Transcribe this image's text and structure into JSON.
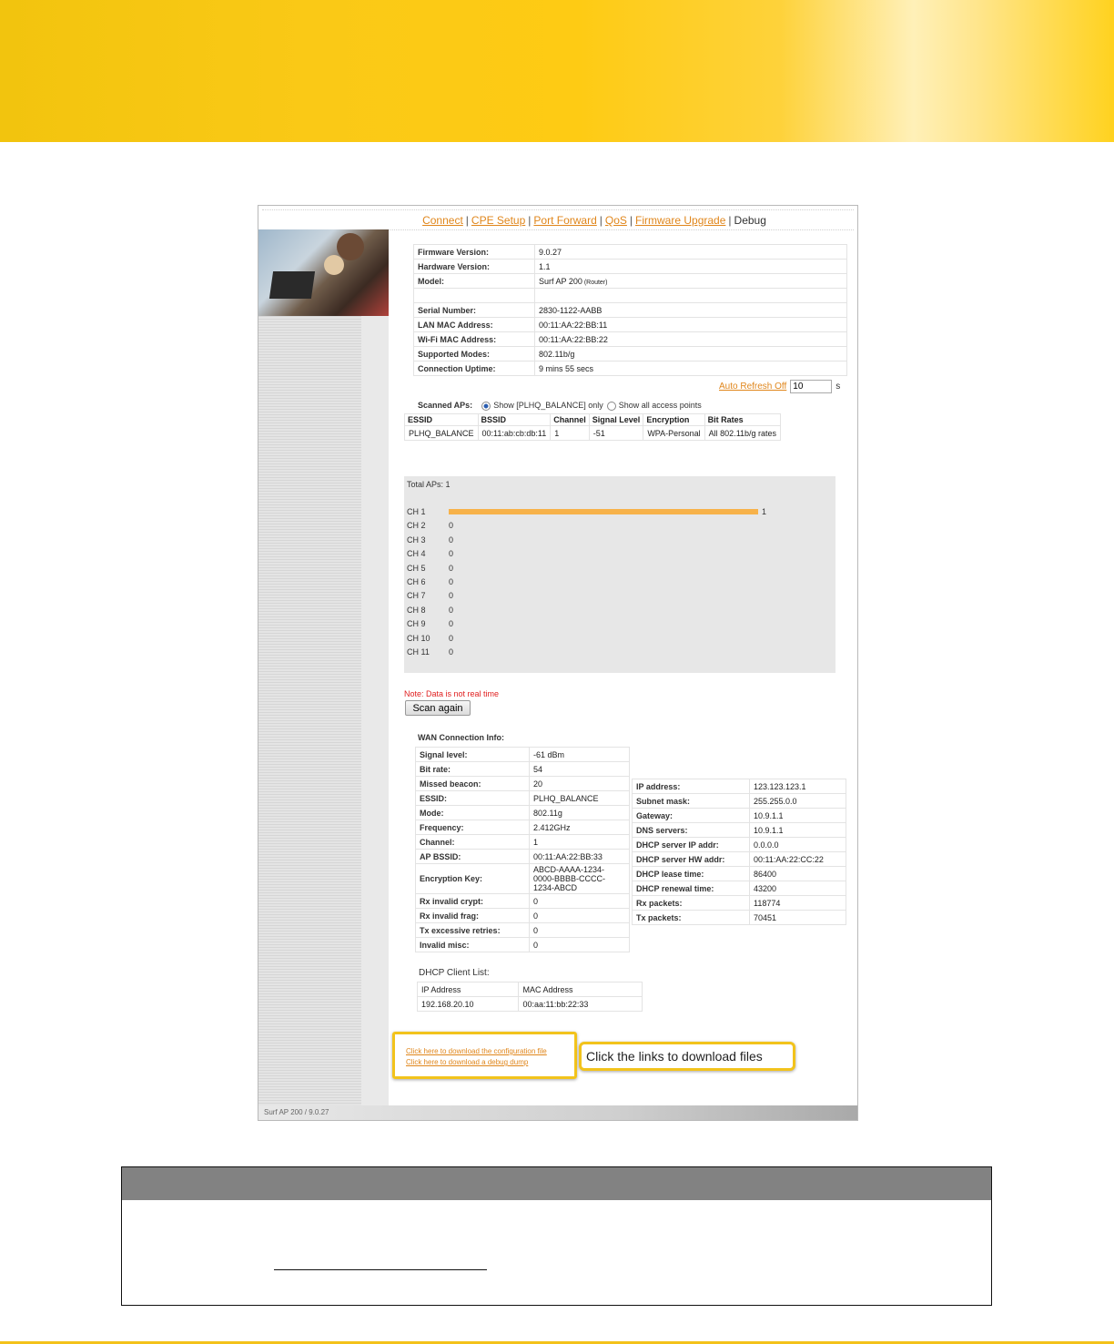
{
  "nav": {
    "items": [
      "Connect",
      "CPE Setup",
      "Port Forward",
      "QoS",
      "Firmware Upgrade"
    ],
    "current": "Debug"
  },
  "info": [
    {
      "k": "Firmware Version:",
      "v": "9.0.27"
    },
    {
      "k": "Hardware Version:",
      "v": "1.1"
    },
    {
      "k": "Model:",
      "v": "Surf AP 200",
      "extra": "(Router)"
    },
    {
      "k": "",
      "v": ""
    },
    {
      "k": "Serial Number:",
      "v": "2830-1122-AABB"
    },
    {
      "k": "LAN MAC Address:",
      "v": "00:11:AA:22:BB:11"
    },
    {
      "k": "Wi-Fi MAC Address:",
      "v": "00:11:AA:22:BB:22"
    },
    {
      "k": "Supported Modes:",
      "v": "802.11b/g"
    },
    {
      "k": "Connection Uptime:",
      "v": "9 mins 55 secs"
    }
  ],
  "refresh": {
    "link": "Auto Refresh Off",
    "value": "10",
    "unit": "s"
  },
  "scan": {
    "label": "Scanned APs:",
    "opt1": "Show [PLHQ_BALANCE] only",
    "opt2": "Show all access points"
  },
  "ap_table": {
    "headers": [
      "ESSID",
      "BSSID",
      "Channel",
      "Signal Level",
      "Encryption",
      "Bit Rates"
    ],
    "rows": [
      [
        "PLHQ_BALANCE",
        "00:11:ab:cb:db:11",
        "1",
        "-51",
        "WPA-Personal",
        "All 802.11b/g rates"
      ]
    ]
  },
  "chart_data": {
    "type": "bar",
    "title": "Total APs: 1",
    "categories": [
      "CH 1",
      "CH 2",
      "CH 3",
      "CH 4",
      "CH 5",
      "CH 6",
      "CH 7",
      "CH 8",
      "CH 9",
      "CH 10",
      "CH 11"
    ],
    "values": [
      1,
      0,
      0,
      0,
      0,
      0,
      0,
      0,
      0,
      0,
      0
    ],
    "orientation": "horizontal",
    "bar_color": "#f7b24a"
  },
  "note": "Note: Data is not real time",
  "scan_button": "Scan again",
  "wan": {
    "heading": "WAN Connection Info:",
    "left": [
      {
        "k": "Signal level:",
        "v": "-61 dBm"
      },
      {
        "k": "Bit rate:",
        "v": "54"
      },
      {
        "k": "Missed beacon:",
        "v": "20"
      },
      {
        "k": "ESSID:",
        "v": "PLHQ_BALANCE"
      },
      {
        "k": "Mode:",
        "v": "802.11g"
      },
      {
        "k": "Frequency:",
        "v": "2.412GHz"
      },
      {
        "k": "Channel:",
        "v": "1"
      },
      {
        "k": "AP BSSID:",
        "v": "00:11:AA:22:BB:33"
      },
      {
        "k": "Encryption Key:",
        "v": "ABCD-AAAA-1234-0000-BBBB-CCCC-1234-ABCD"
      },
      {
        "k": "Rx invalid crypt:",
        "v": "0"
      },
      {
        "k": "Rx invalid frag:",
        "v": "0"
      },
      {
        "k": "Tx excessive retries:",
        "v": "0"
      },
      {
        "k": "Invalid misc:",
        "v": "0"
      }
    ],
    "right": [
      {
        "k": "IP address:",
        "v": "123.123.123.1"
      },
      {
        "k": "Subnet mask:",
        "v": "255.255.0.0"
      },
      {
        "k": "Gateway:",
        "v": "10.9.1.1"
      },
      {
        "k": "DNS servers:",
        "v": "10.9.1.1"
      },
      {
        "k": "DHCP server IP addr:",
        "v": "0.0.0.0"
      },
      {
        "k": "DHCP server HW addr:",
        "v": "00:11:AA:22:CC:22"
      },
      {
        "k": "DHCP lease time:",
        "v": "86400"
      },
      {
        "k": "DHCP renewal time:",
        "v": "43200"
      },
      {
        "k": "Rx packets:",
        "v": "118774"
      },
      {
        "k": "Tx packets:",
        "v": "70451"
      }
    ]
  },
  "dhcp": {
    "heading": "DHCP Client List:",
    "headers": [
      "IP Address",
      "MAC Address"
    ],
    "rows": [
      [
        "192.168.20.10",
        "00:aa:11:bb:22:33"
      ]
    ]
  },
  "downloads": {
    "config": "Click here to download the configuration file",
    "debug": "Click here to download a debug dump"
  },
  "callout": "Click the links to download files",
  "footer": "Surf AP 200 / 9.0.27",
  "colors": {
    "banner": "#fecb14",
    "link": "#e0861b",
    "highlight": "#f2c31c",
    "panel_header": "#828282"
  }
}
